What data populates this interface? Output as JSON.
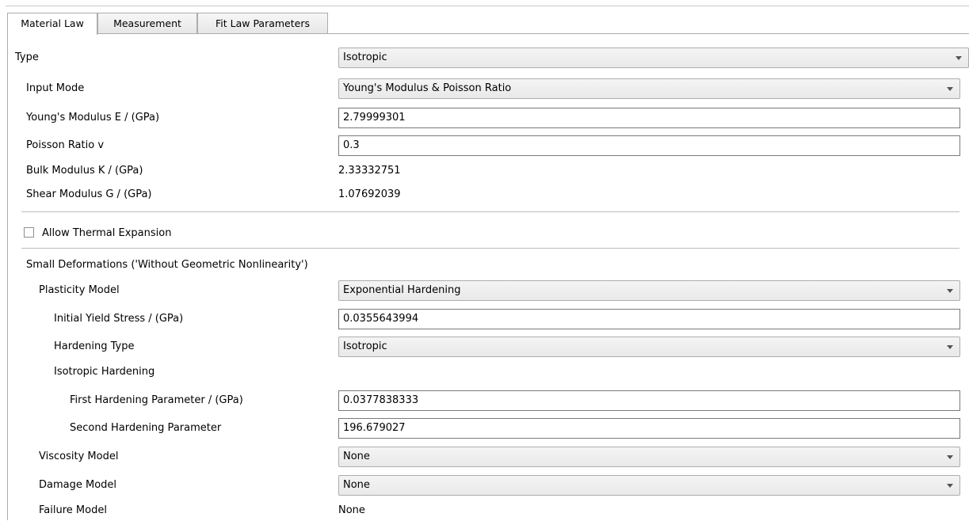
{
  "tabs": [
    {
      "label": "Material Law",
      "active": true
    },
    {
      "label": "Measurement",
      "active": false
    },
    {
      "label": "Fit Law Parameters",
      "active": false
    }
  ],
  "type": {
    "label": "Type",
    "value": "Isotropic"
  },
  "input_mode": {
    "label": "Input Mode",
    "value": "Young's Modulus & Poisson Ratio"
  },
  "youngs_modulus": {
    "label": "Young's Modulus E / (GPa)",
    "value": "2.79999301"
  },
  "poisson_ratio": {
    "label": "Poisson Ratio v",
    "value": "0.3"
  },
  "bulk_modulus": {
    "label": "Bulk Modulus K / (GPa)",
    "value": "2.33332751"
  },
  "shear_modulus": {
    "label": "Shear Modulus G / (GPa)",
    "value": "1.07692039"
  },
  "thermal_expansion": {
    "label": "Allow Thermal Expansion",
    "checked": false
  },
  "small_deformations": {
    "label": "Small Deformations ('Without Geometric Nonlinearity')"
  },
  "plasticity_model": {
    "label": "Plasticity Model",
    "value": "Exponential Hardening"
  },
  "initial_yield_stress": {
    "label": "Initial Yield Stress / (GPa)",
    "value": "0.0355643994"
  },
  "hardening_type": {
    "label": "Hardening Type",
    "value": "Isotropic"
  },
  "isotropic_hardening": {
    "label": "Isotropic Hardening"
  },
  "first_hardening": {
    "label": "First Hardening Parameter / (GPa)",
    "value": "0.0377838333"
  },
  "second_hardening": {
    "label": "Second Hardening Parameter",
    "value": "196.679027"
  },
  "viscosity_model": {
    "label": "Viscosity Model",
    "value": "None"
  },
  "damage_model": {
    "label": "Damage Model",
    "value": "None"
  },
  "failure_model": {
    "label": "Failure Model",
    "value": "None"
  }
}
